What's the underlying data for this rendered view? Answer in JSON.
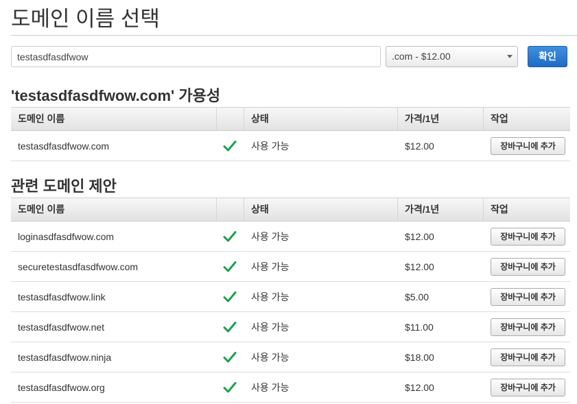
{
  "page": {
    "title": "도메인 이름 선택"
  },
  "search": {
    "value": "testasdfasdfwow",
    "tld_selected": ".com - $12.00",
    "confirm_label": "확인"
  },
  "columns": {
    "domain": "도메인 이름",
    "status": "상태",
    "price": "가격/1년",
    "action": "작업"
  },
  "availability": {
    "title": "'testasdfasdfwow.com' 가용성",
    "rows": [
      {
        "domain": "testasdfasdfwow.com",
        "status": "사용 가능",
        "price": "$12.00",
        "action": "장바구니에 추가"
      }
    ]
  },
  "suggestions": {
    "title": "관련 도메인 제안",
    "rows": [
      {
        "domain": "loginasdfasdfwow.com",
        "status": "사용 가능",
        "price": "$12.00",
        "action": "장바구니에 추가"
      },
      {
        "domain": "securetestasdfasdfwow.com",
        "status": "사용 가능",
        "price": "$12.00",
        "action": "장바구니에 추가"
      },
      {
        "domain": "testasdfasdfwow.link",
        "status": "사용 가능",
        "price": "$5.00",
        "action": "장바구니에 추가"
      },
      {
        "domain": "testasdfasdfwow.net",
        "status": "사용 가능",
        "price": "$11.00",
        "action": "장바구니에 추가"
      },
      {
        "domain": "testasdfasdfwow.ninja",
        "status": "사용 가능",
        "price": "$18.00",
        "action": "장바구니에 추가"
      },
      {
        "domain": "testasdfasdfwow.org",
        "status": "사용 가능",
        "price": "$12.00",
        "action": "장바구니에 추가"
      }
    ]
  },
  "colors": {
    "accent": "#1f6cc4",
    "check": "#1aa14a"
  }
}
